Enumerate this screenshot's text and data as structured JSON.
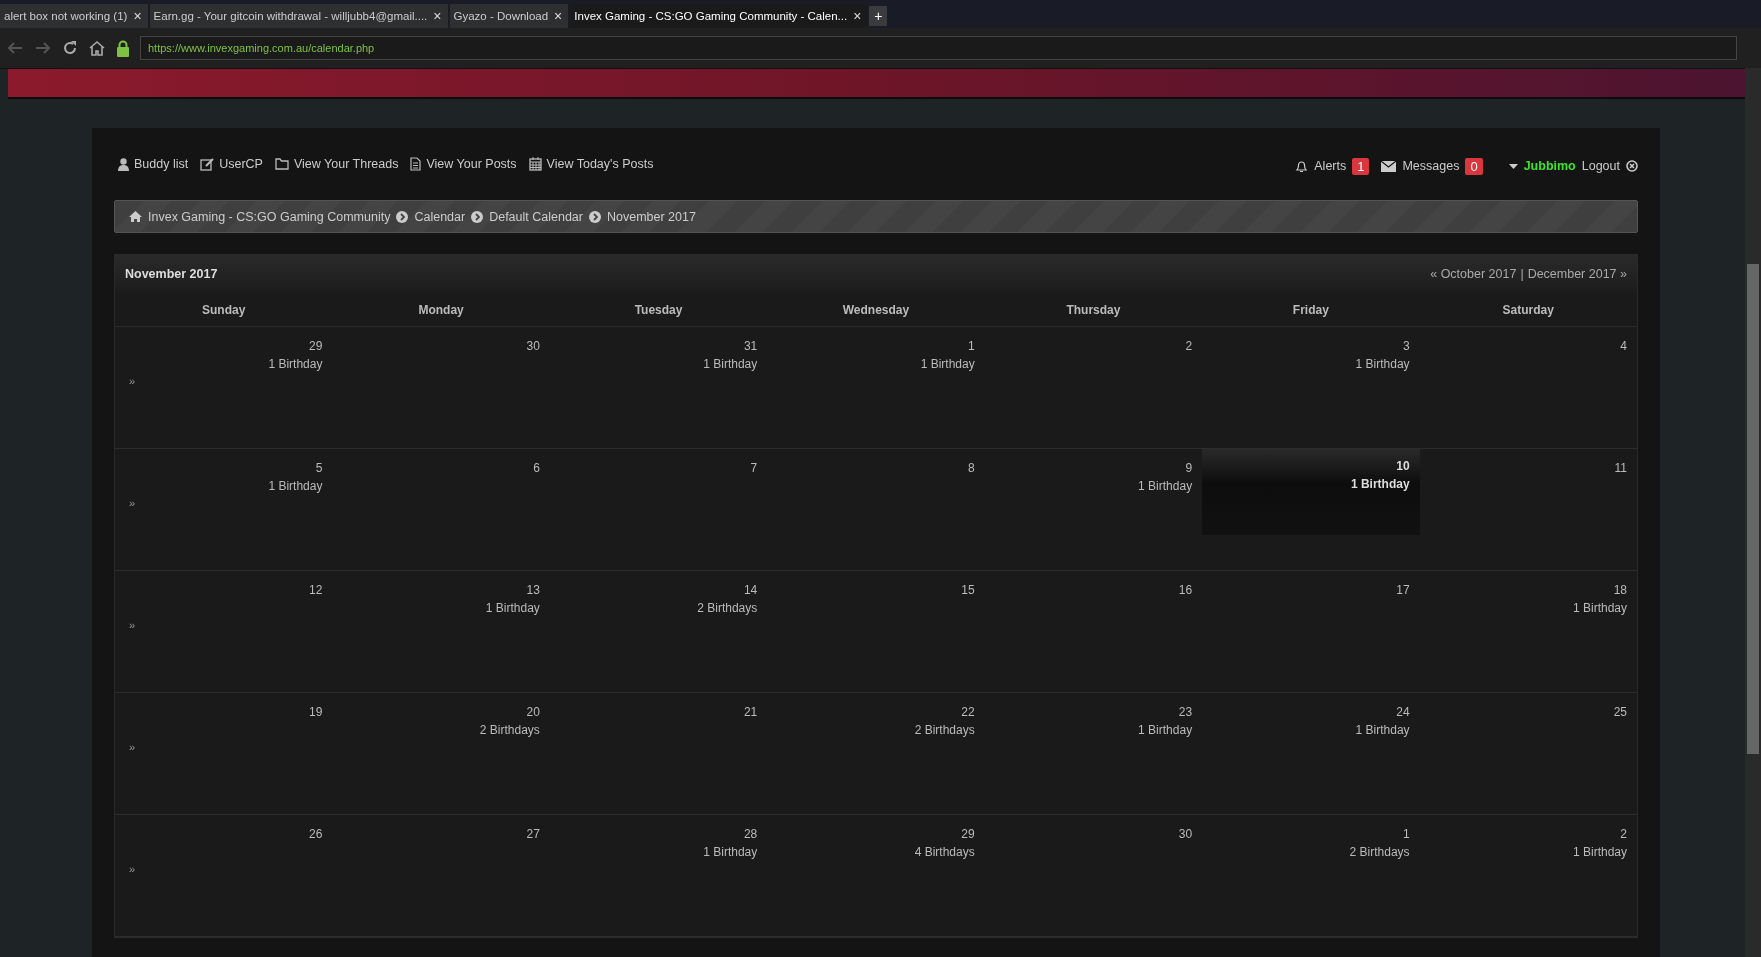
{
  "browser": {
    "tabs": [
      {
        "title": "alert box not working (1)",
        "close": "×",
        "selected": false
      },
      {
        "title": "Earn.gg - Your gitcoin withdrawal - willjubb4@gmail....",
        "close": "×",
        "selected": false
      },
      {
        "title": "Gyazo - Download",
        "close": "×",
        "selected": false
      },
      {
        "title": "Invex Gaming - CS:GO Gaming Community - Calen...",
        "close": "×",
        "selected": true
      }
    ],
    "new_tab": "+",
    "url": "https://www.invexgaming.com.au/calendar.php"
  },
  "nav_links": [
    {
      "label": "Buddy list",
      "kind": "user"
    },
    {
      "label": "UserCP",
      "kind": "edit"
    },
    {
      "label": "View Your Threads",
      "kind": "folder"
    },
    {
      "label": "View Your Posts",
      "kind": "file"
    },
    {
      "label": "View Today's Posts",
      "kind": "calendar"
    }
  ],
  "user_bar": {
    "alerts": {
      "label": "Alerts",
      "count": "1"
    },
    "messages": {
      "label": "Messages",
      "count": "0"
    },
    "username": "Jubbimo",
    "logout": "Logout"
  },
  "breadcrumb": [
    "Invex Gaming - CS:GO Gaming Community",
    "Calendar",
    "Default Calendar",
    "November 2017"
  ],
  "calendar": {
    "title": "November 2017",
    "prev": "« October 2017",
    "separator": "|",
    "next": "December 2017 »",
    "weekdays": [
      "Sunday",
      "Monday",
      "Tuesday",
      "Wednesday",
      "Thursday",
      "Friday",
      "Saturday"
    ],
    "weeks": [
      {
        "link": "»",
        "days": [
          {
            "day": "29",
            "events": "1 Birthday",
            "today": false
          },
          {
            "day": "30",
            "today": false
          },
          {
            "day": "31",
            "events": "1 Birthday",
            "today": false
          },
          {
            "day": "1",
            "events": "1 Birthday",
            "today": false
          },
          {
            "day": "2",
            "today": false
          },
          {
            "day": "3",
            "events": "1 Birthday",
            "today": false
          },
          {
            "day": "4",
            "today": false
          }
        ]
      },
      {
        "link": "»",
        "days": [
          {
            "day": "5",
            "events": "1 Birthday",
            "today": false
          },
          {
            "day": "6",
            "today": false
          },
          {
            "day": "7",
            "today": false
          },
          {
            "day": "8",
            "today": false
          },
          {
            "day": "9",
            "events": "1 Birthday",
            "today": false
          },
          {
            "day": "10",
            "events": "1 Birthday",
            "today": true
          },
          {
            "day": "11",
            "today": false
          }
        ]
      },
      {
        "link": "»",
        "days": [
          {
            "day": "12",
            "today": false
          },
          {
            "day": "13",
            "events": "1 Birthday",
            "today": false
          },
          {
            "day": "14",
            "events": "2 Birthdays",
            "today": false
          },
          {
            "day": "15",
            "today": false
          },
          {
            "day": "16",
            "today": false
          },
          {
            "day": "17",
            "today": false
          },
          {
            "day": "18",
            "events": "1 Birthday",
            "today": false
          }
        ]
      },
      {
        "link": "»",
        "days": [
          {
            "day": "19",
            "today": false
          },
          {
            "day": "20",
            "events": "2 Birthdays",
            "today": false
          },
          {
            "day": "21",
            "today": false
          },
          {
            "day": "22",
            "events": "2 Birthdays",
            "today": false
          },
          {
            "day": "23",
            "events": "1 Birthday",
            "today": false
          },
          {
            "day": "24",
            "events": "1 Birthday",
            "today": false
          },
          {
            "day": "25",
            "today": false
          }
        ]
      },
      {
        "link": "»",
        "days": [
          {
            "day": "26",
            "today": false
          },
          {
            "day": "27",
            "today": false
          },
          {
            "day": "28",
            "events": "1 Birthday",
            "today": false
          },
          {
            "day": "29",
            "events": "4 Birthdays",
            "today": false
          },
          {
            "day": "30",
            "today": false
          },
          {
            "day": "1",
            "events": "2 Birthdays",
            "today": false
          },
          {
            "day": "2",
            "events": "1 Birthday",
            "today": false
          }
        ]
      }
    ]
  }
}
